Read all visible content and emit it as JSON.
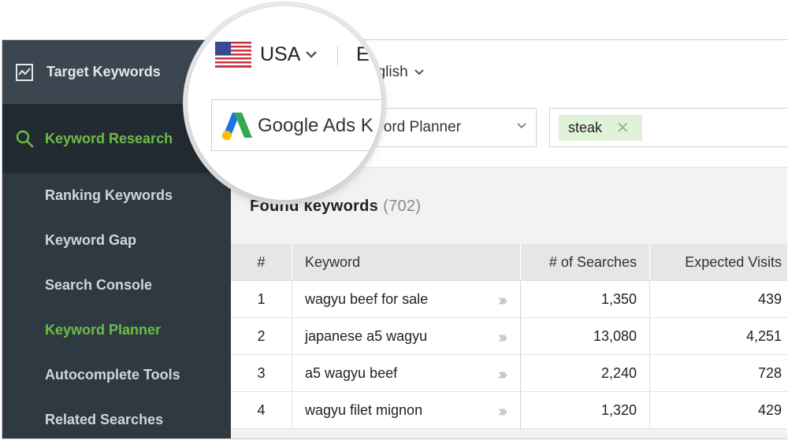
{
  "sidebar": {
    "top_item": {
      "label": "Target Keywords",
      "icon": "chart-line-icon"
    },
    "active_item": {
      "label": "Keyword Research",
      "icon": "search-icon"
    },
    "items": [
      {
        "label": "Ranking Keywords",
        "active": false
      },
      {
        "label": "Keyword Gap",
        "active": false
      },
      {
        "label": "Search Console",
        "active": false
      },
      {
        "label": "Keyword Planner",
        "active": true
      },
      {
        "label": "Autocomplete Tools",
        "active": false
      },
      {
        "label": "Related Searches",
        "active": false
      }
    ]
  },
  "header": {
    "country": "USA",
    "country_flag": "us-flag-icon",
    "language_partial": "E",
    "language": "nglish",
    "service_magnified": "Google Ads K",
    "service": "eyword Planner",
    "tag": "steak"
  },
  "results": {
    "title": "Found keywords",
    "count": "(702)",
    "columns": [
      "#",
      "Keyword",
      "# of Searches",
      "Expected Visits"
    ],
    "rows": [
      {
        "num": "1",
        "keyword": "wagyu beef for sale",
        "searches": "1,350",
        "visits": "439"
      },
      {
        "num": "2",
        "keyword": "japanese a5 wagyu",
        "searches": "13,080",
        "visits": "4,251"
      },
      {
        "num": "3",
        "keyword": "a5 wagyu beef",
        "searches": "2,240",
        "visits": "728"
      },
      {
        "num": "4",
        "keyword": "wagyu filet mignon",
        "searches": "1,320",
        "visits": "429"
      }
    ]
  },
  "colors": {
    "sidebar_bg": "#2f3942",
    "sidebar_active_bg": "#232b32",
    "accent_green": "#6cbd45",
    "tag_bg": "#e0f2d9"
  }
}
